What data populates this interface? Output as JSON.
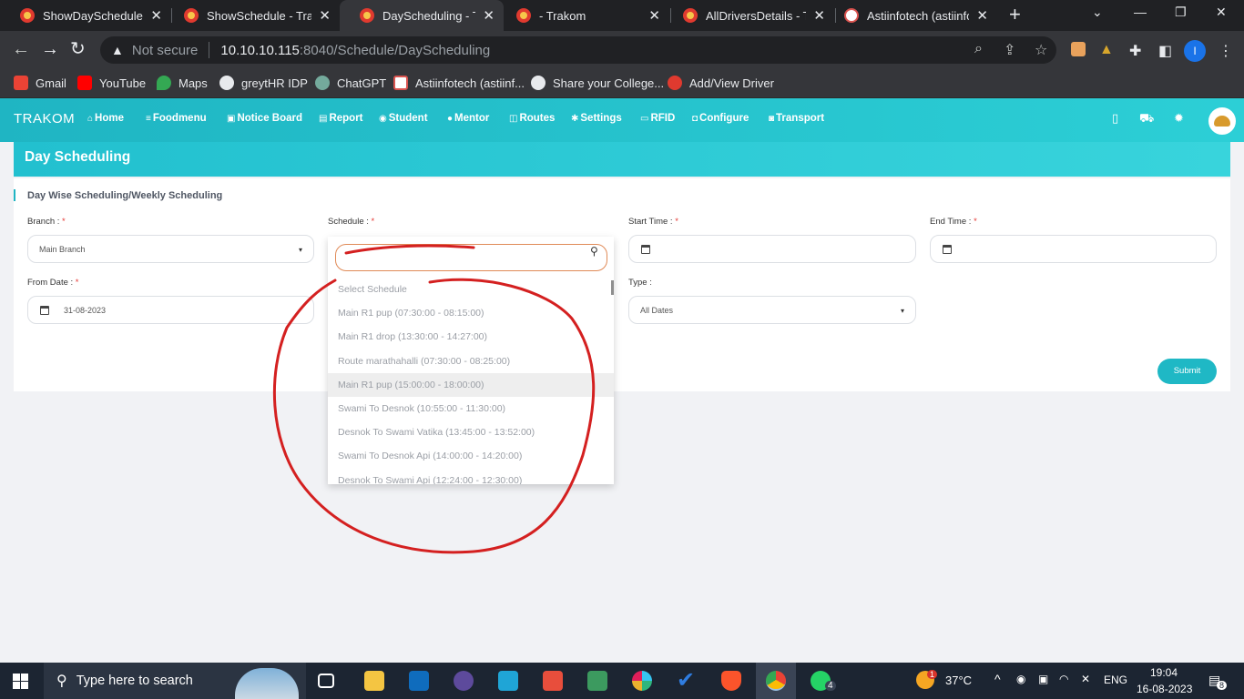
{
  "browser": {
    "tabs": [
      {
        "title": "ShowDaySchedules - T",
        "active": false
      },
      {
        "title": "ShowSchedule - Trako",
        "active": false
      },
      {
        "title": "DayScheduling - Trako",
        "active": true
      },
      {
        "title": "- Trakom",
        "active": false
      },
      {
        "title": "AllDriversDetails - Trak",
        "active": false
      },
      {
        "title": "Astiinfotech (astiinfote",
        "active": false
      }
    ],
    "address": {
      "security": "Not secure",
      "host": "10.10.10.115",
      "path": ":8040/Schedule/DayScheduling"
    },
    "profile_initial": "I",
    "bookmarks": [
      {
        "label": "Gmail",
        "color": "#ea4335"
      },
      {
        "label": "YouTube",
        "color": "#ff0000"
      },
      {
        "label": "Maps",
        "color": "#34a853"
      },
      {
        "label": "greytHR IDP",
        "color": "#e8eaed"
      },
      {
        "label": "ChatGPT",
        "color": "#74aa9c"
      },
      {
        "label": "Astiinfotech (astiinf...",
        "color": "#d9534f"
      },
      {
        "label": "Share your College...",
        "color": "#e8eaed"
      },
      {
        "label": "Add/View Driver",
        "color": "#e03a2f"
      }
    ]
  },
  "app": {
    "brand": "TRAKOM",
    "nav": [
      {
        "icon": "home-icon",
        "glyph": "⌂",
        "label": "Home"
      },
      {
        "icon": "menu-icon",
        "glyph": "≡",
        "label": "Foodmenu"
      },
      {
        "icon": "board-icon",
        "glyph": "▣",
        "label": "Notice Board"
      },
      {
        "icon": "report-icon",
        "glyph": "▤",
        "label": "Report"
      },
      {
        "icon": "student-icon",
        "glyph": "◉",
        "label": "Student"
      },
      {
        "icon": "mentor-icon",
        "glyph": "●",
        "label": "Mentor"
      },
      {
        "icon": "routes-icon",
        "glyph": "◫",
        "label": "Routes"
      },
      {
        "icon": "settings-icon",
        "glyph": "✱",
        "label": "Settings"
      },
      {
        "icon": "rfid-icon",
        "glyph": "▭",
        "label": "RFID"
      },
      {
        "icon": "configure-icon",
        "glyph": "◘",
        "label": "Configure"
      },
      {
        "icon": "transport-icon",
        "glyph": "◙",
        "label": "Transport"
      }
    ],
    "page_title": "Day Scheduling",
    "card_title": "Day Wise Scheduling/Weekly Scheduling",
    "form": {
      "branch": {
        "label": "Branch :",
        "required": "*",
        "value": "Main Branch"
      },
      "schedule": {
        "label": "Schedule :",
        "required": "*",
        "search_value": ""
      },
      "start_time": {
        "label": "Start Time :",
        "required": "*",
        "value": ""
      },
      "end_time": {
        "label": "End Time :",
        "required": "*",
        "value": ""
      },
      "from_date": {
        "label": "From Date :",
        "required": "*",
        "value": "31-08-2023"
      },
      "type": {
        "label": "Type :",
        "value": "All Dates"
      },
      "submit_label": "Submit"
    },
    "schedule_options": [
      "Select Schedule",
      "Main R1 pup (07:30:00 - 08:15:00)",
      "Main R1 drop (13:30:00 - 14:27:00)",
      "Route marathahalli (07:30:00 - 08:25:00)",
      "Main R1 pup (15:00:00 - 18:00:00)",
      "Swami To Desnok (10:55:00 - 11:30:00)",
      "Desnok To Swami Vatika (13:45:00 - 13:52:00)",
      "Swami To Desnok Api (14:00:00 - 14:20:00)",
      "Desnok To Swami Api (12:24:00 - 12:30:00)"
    ],
    "highlighted_option_index": 4,
    "annotation_color": "#d42020"
  },
  "taskbar": {
    "search_placeholder": "Type here to search",
    "weather": "37°C",
    "language": "ENG",
    "time": "19:04",
    "date": "16-08-2023",
    "notifications": "8",
    "whatsapp_badge": "4",
    "weather_badge": "1"
  }
}
